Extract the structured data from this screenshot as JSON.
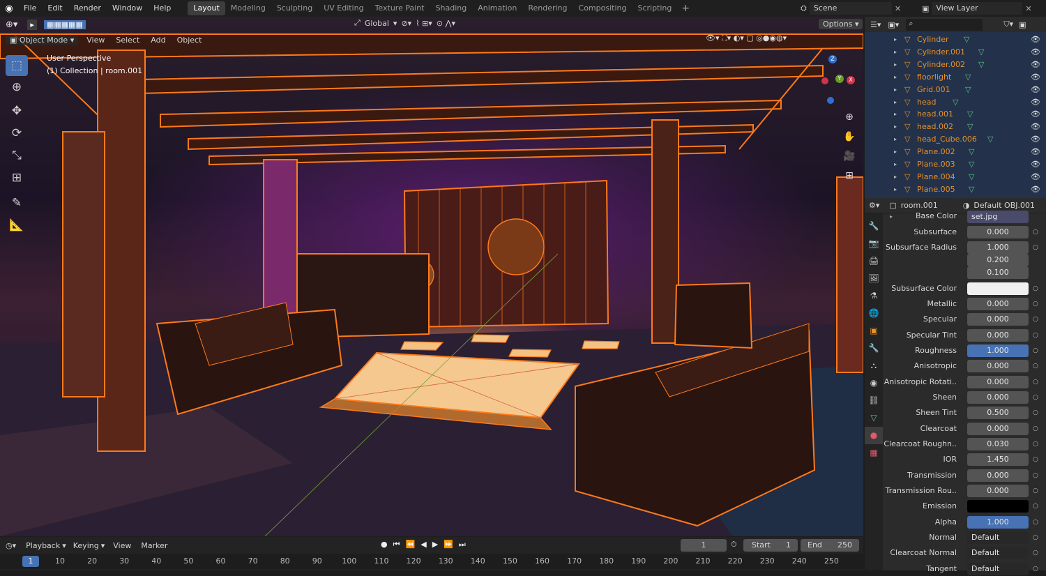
{
  "menu": [
    "File",
    "Edit",
    "Render",
    "Window",
    "Help"
  ],
  "workspaces": [
    "Layout",
    "Modeling",
    "Sculpting",
    "UV Editing",
    "Texture Paint",
    "Shading",
    "Animation",
    "Rendering",
    "Compositing",
    "Scripting"
  ],
  "active_workspace": "Layout",
  "scene": {
    "label": "Scene",
    "view_layer": "View Layer"
  },
  "header": {
    "orientation": "Global",
    "options": "Options",
    "mode": "Object Mode",
    "menus": [
      "View",
      "Select",
      "Add",
      "Object"
    ]
  },
  "overlay": {
    "perspective": "User Perspective",
    "collection": "(1) Collection | room.001"
  },
  "outliner": {
    "items": [
      "Cylinder",
      "Cylinder.001",
      "Cylinder.002",
      "floorlight",
      "Grid.001",
      "head",
      "head.001",
      "head.002",
      "head_Cube.006",
      "Plane.002",
      "Plane.003",
      "Plane.004",
      "Plane.005"
    ]
  },
  "properties": {
    "object": "room.001",
    "material": "Default OBJ.001",
    "base_color": {
      "label": "Base Color",
      "value": "set.jpg"
    },
    "rows": [
      {
        "label": "Subsurface",
        "value": "0.000"
      },
      {
        "label": "Subsurface Radius",
        "value": "1.000"
      },
      {
        "label": "",
        "value": "0.200"
      },
      {
        "label": "",
        "value": "0.100"
      },
      {
        "label": "Subsurface Color",
        "value": ""
      },
      {
        "label": "Metallic",
        "value": "0.000"
      },
      {
        "label": "Specular",
        "value": "0.000"
      },
      {
        "label": "Specular Tint",
        "value": "0.000"
      },
      {
        "label": "Roughness",
        "value": "1.000"
      },
      {
        "label": "Anisotropic",
        "value": "0.000"
      },
      {
        "label": "Anisotropic Rotati..",
        "value": "0.000"
      },
      {
        "label": "Sheen",
        "value": "0.000"
      },
      {
        "label": "Sheen Tint",
        "value": "0.500"
      },
      {
        "label": "Clearcoat",
        "value": "0.000"
      },
      {
        "label": "Clearcoat Roughn..",
        "value": "0.030"
      },
      {
        "label": "IOR",
        "value": "1.450"
      },
      {
        "label": "Transmission",
        "value": "0.000"
      },
      {
        "label": "Transmission Rou..",
        "value": "0.000"
      },
      {
        "label": "Emission",
        "value": ""
      },
      {
        "label": "Alpha",
        "value": "1.000"
      },
      {
        "label": "Normal",
        "value": "Default"
      },
      {
        "label": "Clearcoat Normal",
        "value": "Default"
      },
      {
        "label": "Tangent",
        "value": "Default"
      }
    ]
  },
  "timeline": {
    "menus": [
      "Playback",
      "Keying",
      "View",
      "Marker"
    ],
    "current_frame": "1",
    "start_label": "Start",
    "start": "1",
    "end_label": "End",
    "end": "250",
    "ruler": [
      "1",
      "10",
      "20",
      "30",
      "40",
      "50",
      "60",
      "70",
      "80",
      "90",
      "100",
      "110",
      "120",
      "130",
      "140",
      "150",
      "160",
      "170",
      "180",
      "190",
      "200",
      "210",
      "220",
      "230",
      "240",
      "250"
    ]
  },
  "colors": {
    "accent": "#4772b3",
    "selection": "#ff7a1a",
    "outliner_bg": "#23324a"
  }
}
